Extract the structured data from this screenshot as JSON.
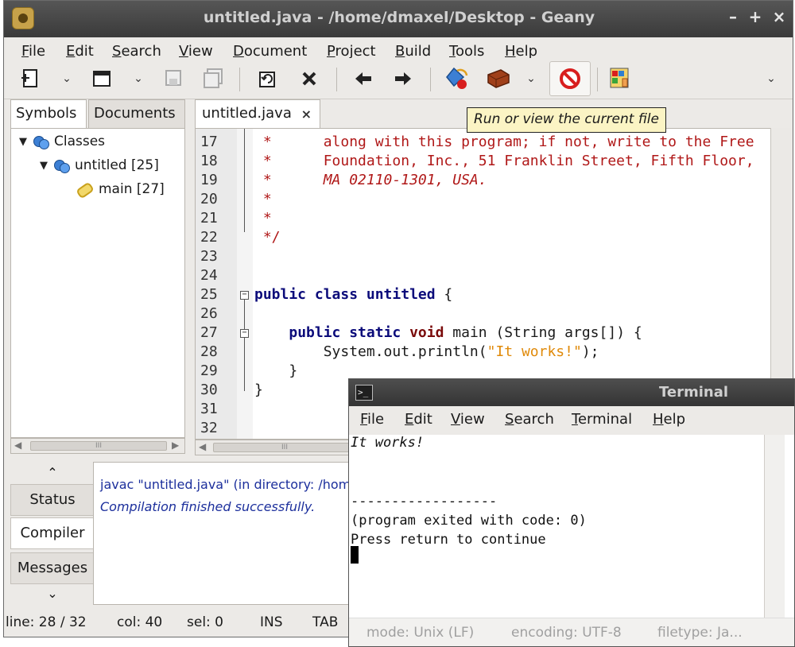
{
  "window": {
    "title": "untitled.java - /home/dmaxel/Desktop - Geany",
    "minimize": "–",
    "maximize": "+",
    "close": "×"
  },
  "menu": [
    "File",
    "Edit",
    "Search",
    "View",
    "Document",
    "Project",
    "Build",
    "Tools",
    "Help"
  ],
  "toolbar": {
    "icons": [
      "new-file-icon",
      "open-file-icon",
      "save-icon",
      "save-all-icon",
      "reload-icon",
      "close-file-icon",
      "back-icon",
      "forward-icon",
      "compile-icon",
      "build-icon",
      "stop-icon",
      "color-chooser-icon"
    ],
    "tooltip": "Run or view the current file",
    "overflow": "⌄"
  },
  "sidebar": {
    "tabs": [
      "Symbols",
      "Documents"
    ],
    "tree": [
      {
        "label": "Classes",
        "icon": "class-icon"
      },
      {
        "label": "untitled [25]",
        "icon": "class-icon"
      },
      {
        "label": "main [27]",
        "icon": "method-icon"
      }
    ]
  },
  "editor": {
    "tab_label": "untitled.java",
    "tab_close": "×",
    "line_numbers": [
      "17",
      "18",
      "19",
      "20",
      "21",
      "22",
      "23",
      "24",
      "25",
      "26",
      "27",
      "28",
      "29",
      "30",
      "31",
      "32"
    ]
  },
  "messages": {
    "tabs": [
      "Status",
      "Compiler",
      "Messages"
    ],
    "up": "⌃",
    "down": "⌄",
    "lines": [
      "javac \"untitled.java\" (in directory: /home/dmaxel/Desktop)",
      "Compilation finished successfully."
    ]
  },
  "statusbar": {
    "line": "line: 28 / 32",
    "col": "col: 40",
    "sel": "sel: 0",
    "ins": "INS",
    "tab": "TAB",
    "mode": "mode: Unix (LF)",
    "encoding": "encoding: UTF-8",
    "filetype": "filetype: Ja..."
  },
  "terminal": {
    "title": "Terminal",
    "menu": [
      "File",
      "Edit",
      "View",
      "Search",
      "Terminal",
      "Help"
    ],
    "lines": [
      "It works!",
      "",
      "",
      "------------------",
      "(program exited with code: 0)",
      "Press return to continue"
    ]
  },
  "colors": {
    "comment": "#b01818",
    "keyword": "#0b0b7a",
    "string": "#e08a0a",
    "tooltip_bg": "#fbf4c4",
    "compiler_msg": "#1c2f9c"
  }
}
